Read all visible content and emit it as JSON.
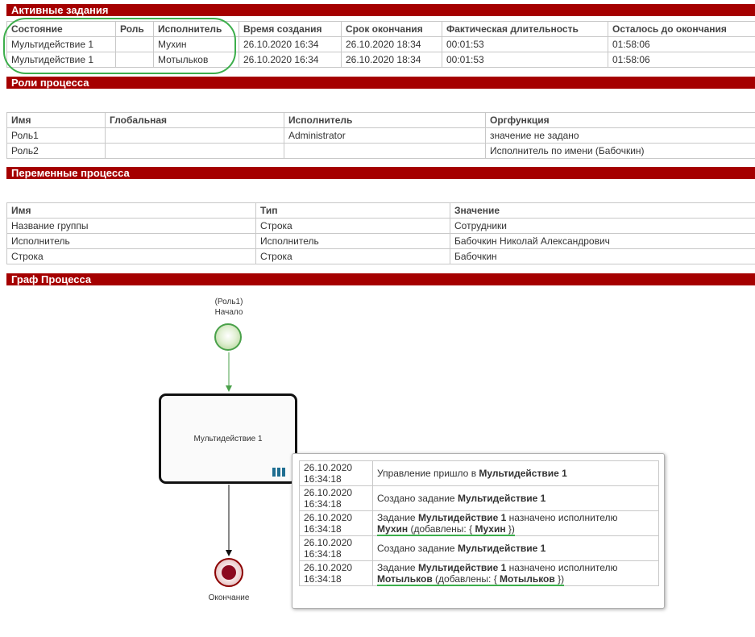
{
  "active_tasks": {
    "title": "Активные задания",
    "columns": [
      "Состояние",
      "Роль",
      "Исполнитель",
      "Время создания",
      "Срок окончания",
      "Фактическая длительность",
      "Осталось до окончания"
    ],
    "rows": [
      [
        "Мультидействие 1",
        "",
        "Мухин",
        "26.10.2020 16:34",
        "26.10.2020 18:34",
        "00:01:53",
        "01:58:06"
      ],
      [
        "Мультидействие 1",
        "",
        "Мотыльков",
        "26.10.2020 16:34",
        "26.10.2020 18:34",
        "00:01:53",
        "01:58:06"
      ]
    ]
  },
  "roles": {
    "title": "Роли процесса",
    "columns": [
      "Имя",
      "Глобальная",
      "Исполнитель",
      "Оргфункция"
    ],
    "rows": [
      [
        "Роль1",
        "",
        "Administrator",
        "значение не задано"
      ],
      [
        "Роль2",
        "",
        "",
        "Исполнитель по имени (Бабочкин)"
      ]
    ]
  },
  "variables": {
    "title": "Переменные процесса",
    "columns": [
      "Имя",
      "Тип",
      "Значение"
    ],
    "rows": [
      [
        "Название группы",
        "Строка",
        "Сотрудники"
      ],
      [
        "Исполнитель",
        "Исполнитель",
        "Бабочкин Николай Александрович"
      ],
      [
        "Строка",
        "Строка",
        "Бабочкин"
      ]
    ]
  },
  "graph": {
    "title": "Граф Процесса",
    "start_role": "(Роль1)",
    "start_label": "Начало",
    "task_label": "Мультидействие 1",
    "end_label": "Окончание",
    "multi_icon": "parallel-multi-instance-icon"
  },
  "history": {
    "entries": [
      {
        "date": "26.10.2020",
        "time": "16:34:18",
        "text1": "Управление пришло в ",
        "b1": "Мультидействие 1"
      },
      {
        "date": "26.10.2020",
        "time": "16:34:18",
        "text1": "Создано задание ",
        "b1": "Мультидействие 1"
      },
      {
        "date": "26.10.2020",
        "time": "16:34:18",
        "text1": "Задание ",
        "b1": "Мультидействие 1",
        "text2": " назначено исполнителю",
        "b2": "Мухин",
        "text3": " (добавлены: { ",
        "b3": "Мухин",
        "text4": " })"
      },
      {
        "date": "26.10.2020",
        "time": "16:34:18",
        "text1": "Создано задание ",
        "b1": "Мультидействие 1"
      },
      {
        "date": "26.10.2020",
        "time": "16:34:18",
        "text1": "Задание ",
        "b1": "Мультидействие 1",
        "text2": " назначено исполнителю",
        "b2": "Мотыльков",
        "text3": " (добавлены: { ",
        "b3": "Мотыльков",
        "text4": " })"
      }
    ]
  },
  "colors": {
    "header_bg": "#a50000",
    "highlight": "#3cae4b",
    "start_border": "#4aa14a",
    "end_fill": "#8b0a1f",
    "multi_icon": "#1f6e91"
  }
}
